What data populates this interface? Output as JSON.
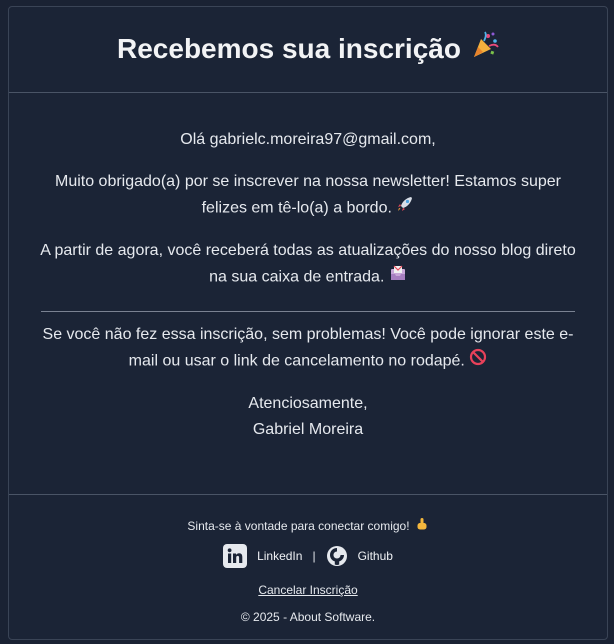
{
  "email": {
    "title": "Recebemos sua inscrição",
    "greeting": "Olá gabrielc.moreira97@gmail.com,",
    "thanks": "Muito obrigado(a) por se inscrever na nossa newsletter! Estamos super felizes em tê-lo(a) a bordo.",
    "updates": "A partir de agora, você receberá todas as atualizações do nosso blog direto na sua caixa de entrada.",
    "not_you": "Se você não fez essa inscrição, sem problemas! Você pode ignorar este e-mail ou usar o link de cancelamento no rodapé.",
    "signoff": "Atenciosamente,",
    "sender": "Gabriel Moreira"
  },
  "footer": {
    "connect_text": "Sinta-se à vontade para conectar comigo!",
    "linkedin_label": "LinkedIn",
    "separator": "|",
    "github_label": "Github",
    "unsubscribe_label": "Cancelar Inscrição",
    "copyright": "© 2025 - About Software."
  },
  "icons": {
    "title_icon": "party-popper-icon",
    "thanks_icon": "rocket-icon",
    "updates_icon": "inbox-envelope-icon",
    "not_you_icon": "no-entry-icon",
    "connect_icon": "pointing-down-icon",
    "linkedin": "linkedin-icon",
    "github": "github-icon"
  },
  "colors": {
    "background": "#1a2233",
    "card": "#1b2436",
    "text": "#e6e9ee",
    "divider": "#4a5466"
  }
}
